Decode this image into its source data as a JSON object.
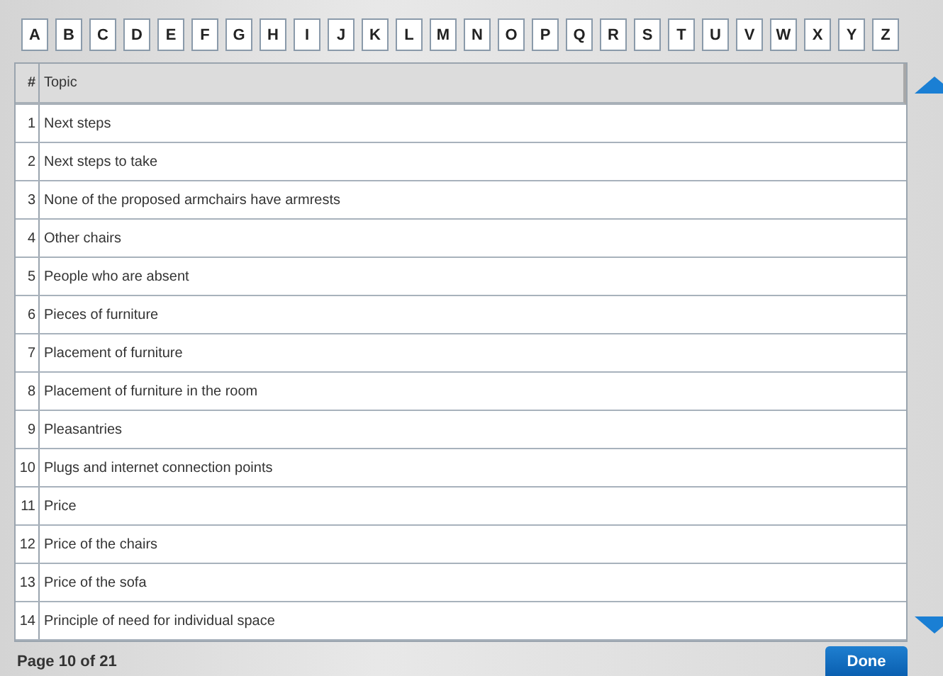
{
  "letters": [
    "A",
    "B",
    "C",
    "D",
    "E",
    "F",
    "G",
    "H",
    "I",
    "J",
    "K",
    "L",
    "M",
    "N",
    "O",
    "P",
    "Q",
    "R",
    "S",
    "T",
    "U",
    "V",
    "W",
    "X",
    "Y",
    "Z"
  ],
  "table": {
    "columns": [
      "#",
      "Topic"
    ],
    "rows": [
      {
        "number": "1",
        "topic": "Next steps"
      },
      {
        "number": "2",
        "topic": "Next steps to take"
      },
      {
        "number": "3",
        "topic": "None of the proposed armchairs have armrests"
      },
      {
        "number": "4",
        "topic": "Other chairs"
      },
      {
        "number": "5",
        "topic": "People who are absent"
      },
      {
        "number": "6",
        "topic": "Pieces of furniture"
      },
      {
        "number": "7",
        "topic": "Placement of furniture"
      },
      {
        "number": "8",
        "topic": "Placement of furniture in the room"
      },
      {
        "number": "9",
        "topic": "Pleasantries"
      },
      {
        "number": "10",
        "topic": "Plugs and internet connection points"
      },
      {
        "number": "11",
        "topic": "Price"
      },
      {
        "number": "12",
        "topic": "Price of the chairs"
      },
      {
        "number": "13",
        "topic": "Price of the sofa"
      },
      {
        "number": "14",
        "topic": "Principle of need for individual space"
      }
    ]
  },
  "footer": {
    "page": "Page 10 of 21",
    "button": "Done"
  }
}
